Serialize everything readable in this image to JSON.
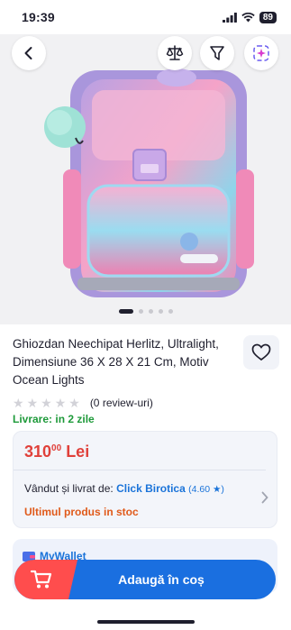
{
  "status": {
    "time": "19:39",
    "battery": "89"
  },
  "product": {
    "title": "Ghiozdan Neechipat Herlitz, Ultralight, Dimensiune 36 X 28 X 21 Cm, Motiv Ocean Lights",
    "review_count": "(0 review-uri)",
    "delivery": "Livrare: in 2 zile",
    "carousel": {
      "total": 5,
      "active": 0
    }
  },
  "offer": {
    "price_main": "310",
    "price_cents": "00",
    "currency": "Lei",
    "seller_prefix": "Vândut și livrat de:",
    "seller_name": "Click Birotica",
    "seller_rating": "(4.60",
    "stock": "Ultimul produs in stoc"
  },
  "wallet": {
    "label": "MyWallet"
  },
  "cart": {
    "label": "Adaugă în coș"
  },
  "colors": {
    "accent": "#1a6fe0",
    "price": "#e0403a",
    "delivery": "#1e9a3a",
    "stock": "#e05a1a",
    "cart_icon_bg": "#ff4d4d"
  },
  "icons": [
    "back-arrow-icon",
    "compare-scale-icon",
    "filter-icon",
    "ai-sparkle-icon",
    "heart-icon",
    "star-icon",
    "chevron-right-icon",
    "wallet-icon",
    "shopping-cart-icon"
  ]
}
